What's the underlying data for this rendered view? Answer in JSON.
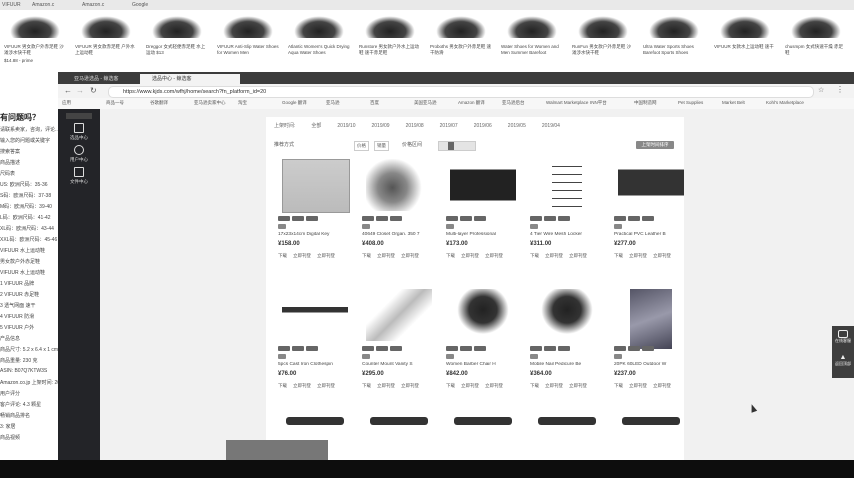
{
  "bg_tabs": [
    "VIFUUR",
    "Amazon.c",
    "Amazon.c",
    "Google",
    "亚马逊选品",
    "Amazon",
    "Amazon"
  ],
  "shoes": [
    {
      "caption": "VIFUUR 男女款户外赤足鞋 沙滩涉水快干鞋",
      "price": "$14.88 - prime"
    },
    {
      "caption": "VIFUUR 男女款赤足鞋 户外水上运动鞋",
      "price": ""
    },
    {
      "caption": "Dreggor 女式轻便赤足鞋 水上运动 $13",
      "price": ""
    },
    {
      "caption": "VIFUUR Anti-Slip Water Shoes for Women Men",
      "price": ""
    },
    {
      "caption": "Atlantic Women's Quick Drying Aqua Water Shoes",
      "price": ""
    },
    {
      "caption": "Runstore 男女款户外水上运动鞋 速干赤足鞋",
      "price": ""
    },
    {
      "caption": "Proboths 男女款户外赤足鞋 速干防滑",
      "price": ""
    },
    {
      "caption": "Water Shoes for Women and Men Summer Barefoot",
      "price": ""
    },
    {
      "caption": "RunFun 男女款户外赤足鞋 沙滩涉水快干鞋",
      "price": ""
    },
    {
      "caption": "Ultra Water Sports Shoes Barefoot Sports Shoes",
      "price": ""
    },
    {
      "caption": "VIFUUR 女款水上运动鞋 速干",
      "price": ""
    },
    {
      "caption": "chusmpm 女式快速干燥 赤足鞋",
      "price": ""
    }
  ],
  "left_page": {
    "heading": "有问题吗？",
    "lines": [
      "请联系卖家，咨询，评论...",
      "输入您的问题或关键字",
      "搜索答案",
      "商品描述",
      "尺码表",
      "US:  欧洲尺码：35-36",
      "S码：欧洲尺码：37-38",
      "M码：欧洲尺码：39-40",
      "L码：欧洲尺码：41-42",
      "XL码：欧洲尺码：43-44",
      "XXL码：欧洲尺码：45-46",
      "VIFUUR 水上运动鞋",
      "男女款户外赤足鞋",
      "VIFUUR 水上运动鞋",
      "1 VIFUUR 品牌",
      "2 VIFUUR 赤足鞋",
      "3 透气网面 速干",
      "4 VIFUUR 防滑",
      "5 VIFUUR 户外",
      "产品信息",
      "商品尺寸: 5.2 x 6.4 x 1 cm",
      "商品重量: 230 克",
      "ASIN: B07Q7KTW3S",
      "Amazon.co.jp 上架时间: 2019",
      "用户评分",
      "客户评论: 4.3 颗星",
      "畅销商品排名",
      "3: 家居",
      "商品视频"
    ]
  },
  "browser": {
    "tabs": [
      "亚马逊选品 - 鲸选客",
      "选品中心 - 鲸选客"
    ],
    "url": "https://www.kjds.com/wfhj/home/search?fn_platform_id=20",
    "bookmarks": [
      "应用",
      "商品一号",
      "谷歌翻译",
      "亚马逊卖家中心",
      "淘宝",
      "Google 翻译",
      "亚马逊",
      "百度",
      "美国亚马逊",
      "Amazon 翻译",
      "亚马逊后台",
      "Walmart Marketplace",
      "INN平台",
      "中国制造网",
      "Pet Supplies",
      "Market Belt",
      "Kohl's Marketplace"
    ]
  },
  "sidebar": [
    {
      "label": "选品中心"
    },
    {
      "label": "用户中心"
    },
    {
      "label": "文件中心"
    }
  ],
  "filters": {
    "dates": [
      "上架时间:",
      "全部",
      "2019/10",
      "2019/09",
      "2019/08",
      "2019/07",
      "2019/06",
      "2019/05",
      "2019/04"
    ],
    "sort_label": "推荐方式",
    "select_1": "价格",
    "select_2": "销量",
    "toggle_label": "价格区间",
    "sort_button": "上架时间排序"
  },
  "products": [
    {
      "title": "17x23x14cm Digital Key",
      "price": "158.00"
    },
    {
      "title": "40649 Closet Organ. 350 7",
      "price": "408.00"
    },
    {
      "title": "Multi-layer Professional",
      "price": "173.00"
    },
    {
      "title": "4 Tier Wire Mesh Locker",
      "price": "311.00"
    },
    {
      "title": "Practical PVC Leather B",
      "price": "277.00"
    },
    {
      "title": "5pcs Cast Iron Clothespin",
      "price": "76.00"
    },
    {
      "title": "Counter Mount Vanity S",
      "price": "295.00"
    },
    {
      "title": "Women Barber Chair H",
      "price": "842.00"
    },
    {
      "title": "Mobile Nail Pedicure Be",
      "price": "364.00"
    },
    {
      "title": "20PK 60LED Outdoor W",
      "price": "237.00"
    }
  ],
  "product_actions": {
    "currency": "¥",
    "view": "下载",
    "list": "立即刊登",
    "other": "立即刊登"
  },
  "float_tools": [
    "在线客服",
    "返回顶部"
  ],
  "colors": {
    "sidebar": "#232428",
    "accent": "#666666",
    "panel": "#ffffff",
    "content_bg": "#f1f1f1"
  }
}
